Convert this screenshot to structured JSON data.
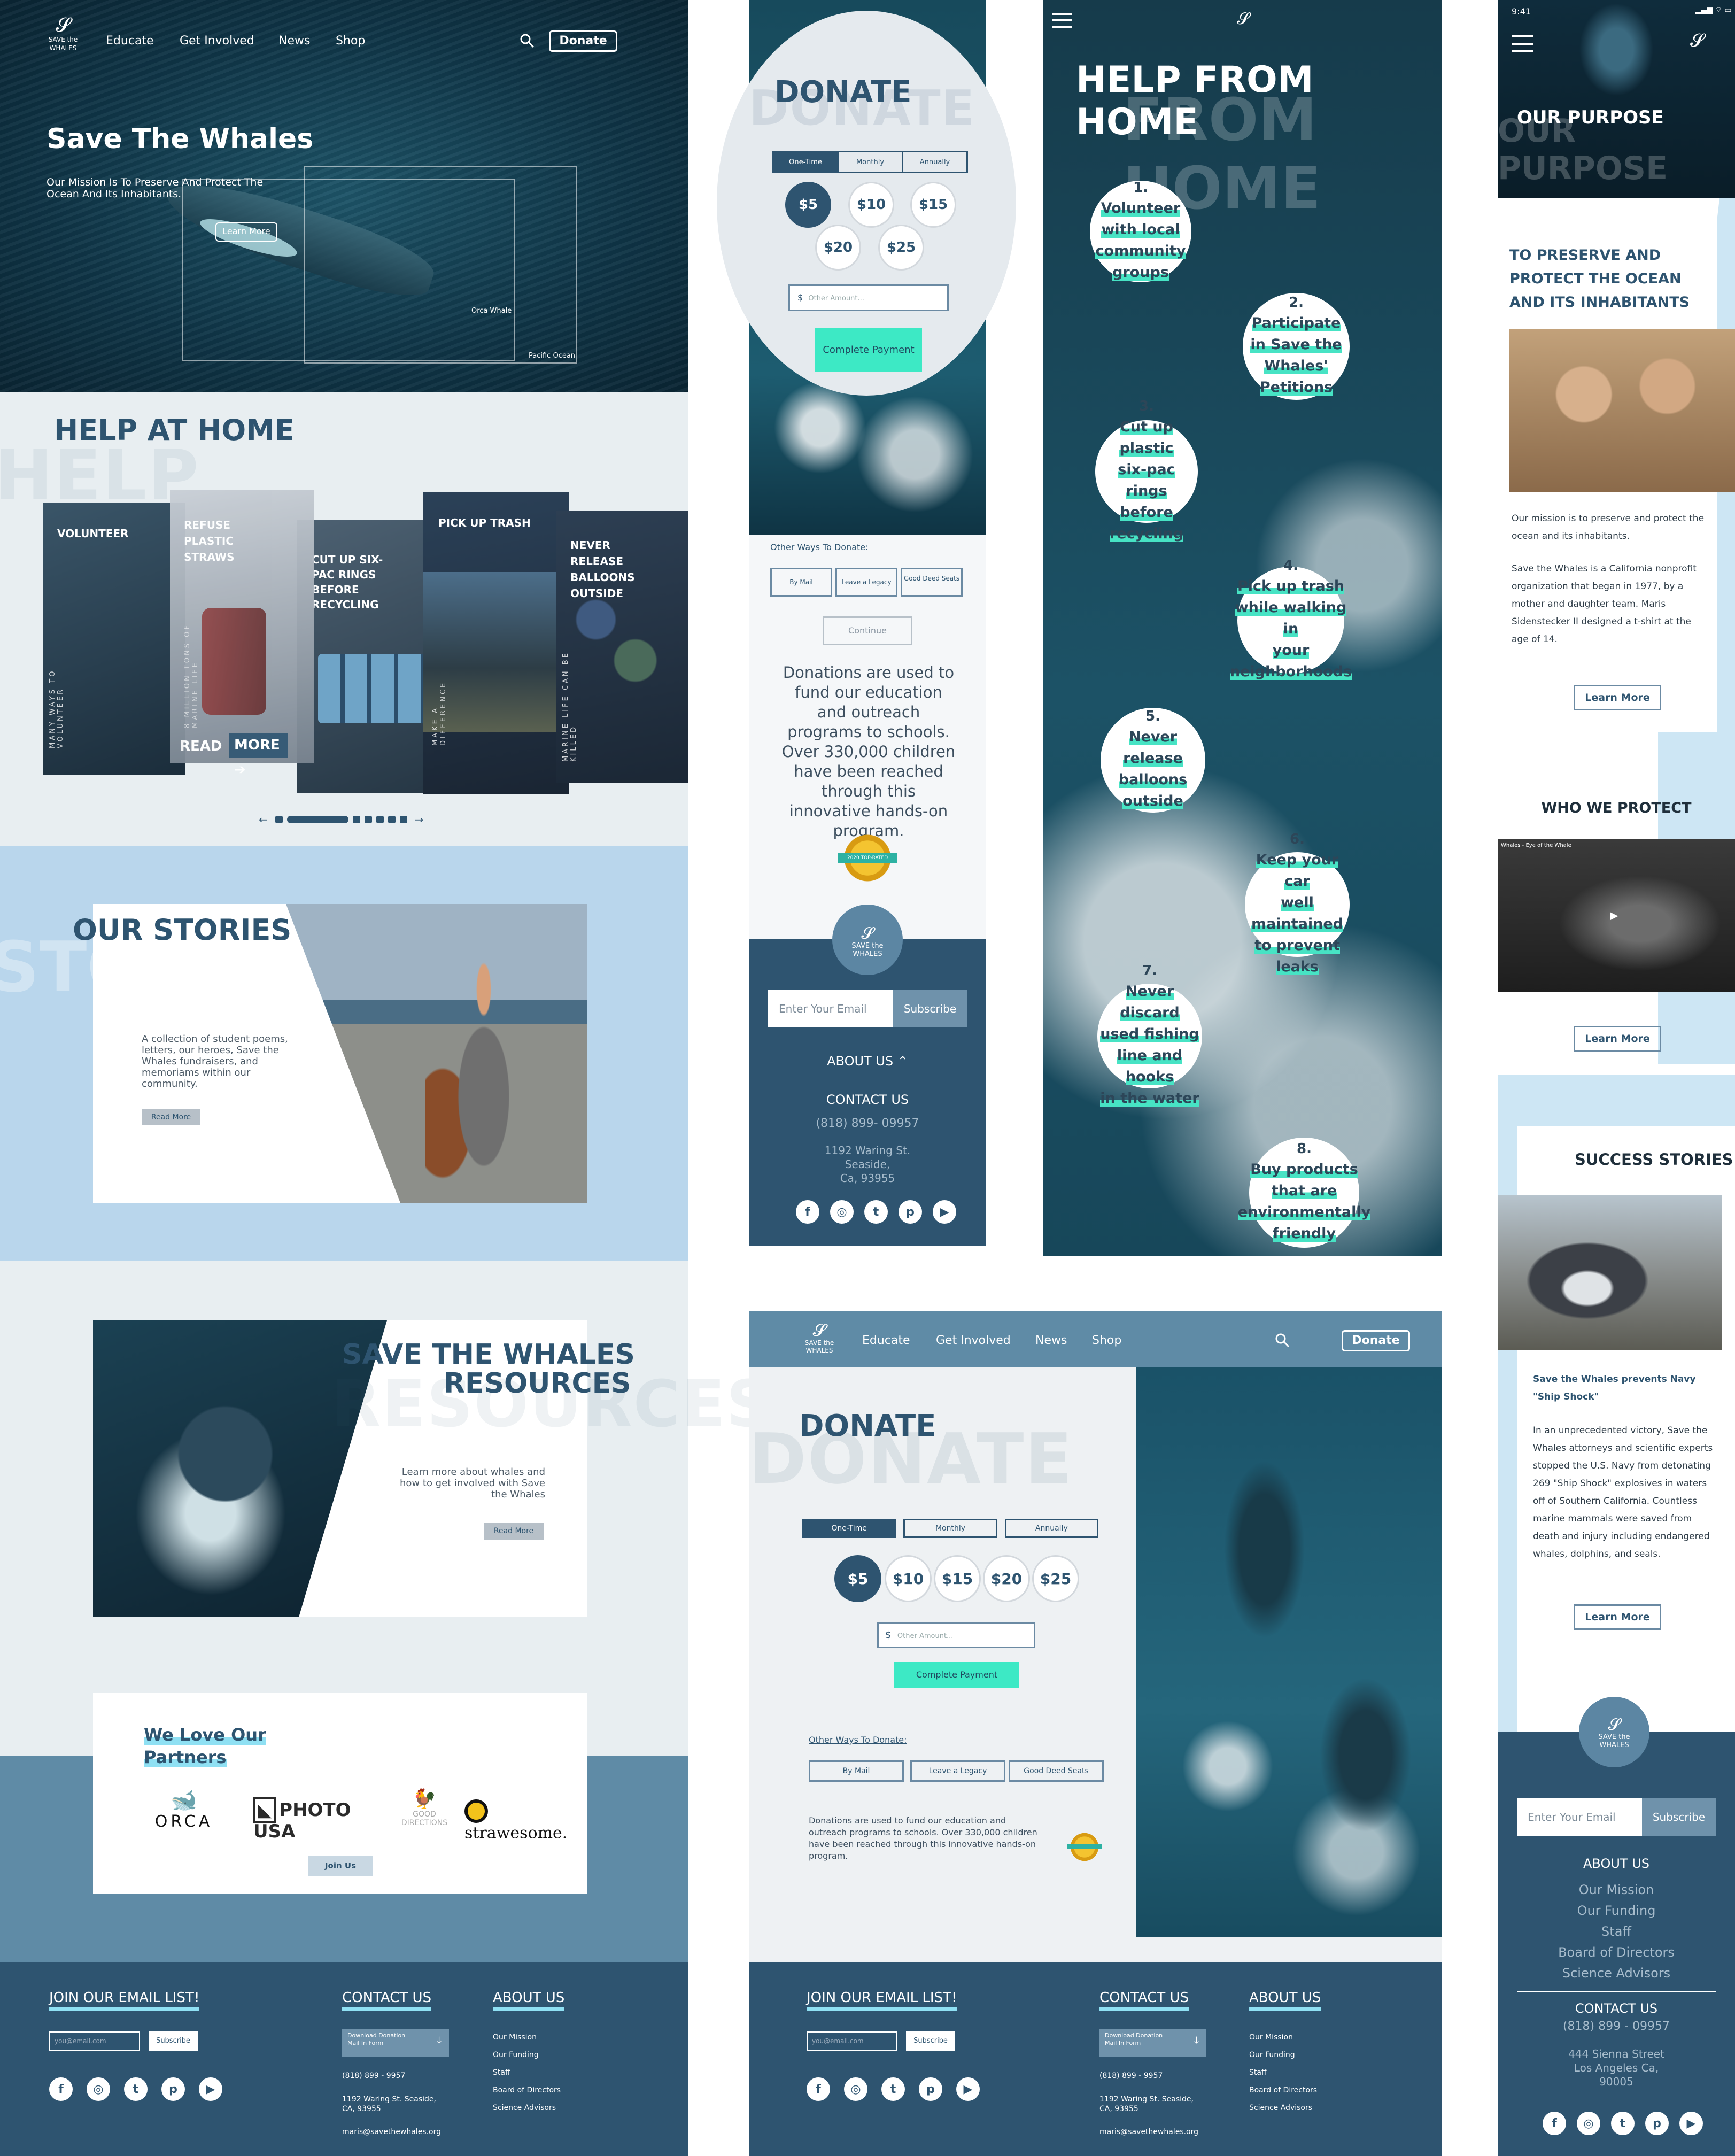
{
  "desktop": {
    "nav": {
      "items": [
        "Educate",
        "Get Involved",
        "News",
        "Shop"
      ],
      "donate": "Donate"
    },
    "hero": {
      "title": "Save The Whales",
      "subtitle": "Our Mission Is To Preserve And Protect The Ocean And Its Inhabitants.",
      "cta": "Learn More",
      "tag1": "Orca Whale",
      "tag2": "Pacific Ocean"
    },
    "help": {
      "title": "HELP AT HOME",
      "ghost": "HELP",
      "cards": [
        {
          "title": "VOLUNTEER",
          "side": "MANY WAYS TO VOLUNTEER"
        },
        {
          "title": "REFUSE PLASTIC STRAWS",
          "side": "8 MILLION TONS OF MARINE LIFE",
          "read": "READ",
          "more": "MORE"
        },
        {
          "title": "CUT UP SIX-PAC RINGS BEFORE RECYCLING",
          "side": ""
        },
        {
          "title": "PICK UP TRASH",
          "side": "MAKE A DIFFERENCE"
        },
        {
          "title": "NEVER RELEASE BALLOONS OUTSIDE",
          "side": "MARINE LIFE CAN BE KILLED"
        }
      ]
    },
    "stories": {
      "title": "OUR STORIES",
      "ghost": "STORIES",
      "text": "A collection of student poems, letters, our heroes, Save the Whales fundraisers, and memoriams within our community.",
      "cta": "Read More"
    },
    "resources": {
      "title1": "SAVE THE WHALES",
      "title2": "RESOURCES",
      "ghost": "RESOURCES",
      "text": "Learn more about whales and how to get involved with Save the Whales",
      "cta": "Read More"
    },
    "partners": {
      "title1": "We Love Our",
      "title2": "Partners",
      "logos": [
        "ORCA",
        "PHOTO USA",
        "GOOD DIRECTIONS",
        "strawesome."
      ],
      "cta": "Join Us"
    },
    "footer": {
      "email_title": "JOIN OUR EMAIL LIST!",
      "email_ph": "you@email.com",
      "subscribe": "Subscribe",
      "contact_title": "CONTACT US",
      "download": "Download Donation Mail In Form",
      "phone": "(818) 899 - 9957",
      "address": "1192 Waring St. Seaside, CA, 93955",
      "email": "maris@savethewhales.org",
      "about_title": "ABOUT US",
      "about_items": [
        "Our Mission",
        "Our Funding",
        "Staff",
        "Board of Directors",
        "Science Advisors"
      ]
    }
  },
  "mobile_donate": {
    "title": "DONATE",
    "ghost": "DONATE",
    "freq": [
      "One-Time",
      "Monthly",
      "Annually"
    ],
    "amounts": [
      "$5",
      "$10",
      "$15",
      "$20",
      "$25"
    ],
    "other_ph": "Other Amount...",
    "pay": "Complete Payment",
    "other_ways": "Other Ways To Donate:",
    "ways": [
      "By Mail",
      "Leave a Legacy",
      "Good Deed Seats"
    ],
    "continue": "Continue",
    "text": "Donations are used to fund our education and outreach programs to schools. Over 330,000 children have been reached through this innovative hands-on program.",
    "badge": "2020 TOP-RATED",
    "footer": {
      "email_ph": "Enter Your Email",
      "subscribe": "Subscribe",
      "about": "ABOUT US",
      "contact": "CONTACT US",
      "phone": "(818) 899- 09957",
      "addr1": "1192 Waring St.",
      "addr2": "Seaside,",
      "addr3": "Ca, 93955"
    }
  },
  "help_from_home": {
    "title": "HELP FROM HOME",
    "ghost": "FROM HOME",
    "steps": [
      {
        "n": "1.",
        "t": [
          "Volunteer",
          "with local",
          "community",
          "groups"
        ]
      },
      {
        "n": "2.",
        "t": [
          "Participate",
          "in Save the",
          "Whales'",
          "Petitions"
        ]
      },
      {
        "n": "3.",
        "t": [
          "Cut up plastic",
          "six-pac rings",
          "before",
          "recycling"
        ]
      },
      {
        "n": "4.",
        "t": [
          "Pick up trash",
          "while walking in",
          "your",
          "neighborhoods"
        ]
      },
      {
        "n": "5.",
        "t": [
          "Never",
          "release",
          "balloons",
          "outside"
        ]
      },
      {
        "n": "6.",
        "t": [
          "Keep your car",
          "well maintained",
          "to prevent leaks"
        ]
      },
      {
        "n": "7.",
        "t": [
          "Never discard",
          "used fishing",
          "line and hooks",
          "in the water"
        ]
      },
      {
        "n": "8.",
        "t": [
          "Buy products",
          "that are",
          "environmentally",
          "friendly"
        ]
      }
    ]
  },
  "desktop_donate": {
    "nav": {
      "items": [
        "Educate",
        "Get Involved",
        "News",
        "Shop"
      ],
      "donate": "Donate"
    },
    "title": "DONATE",
    "ghost": "DONATE",
    "freq": [
      "One-Time",
      "Monthly",
      "Annually"
    ],
    "amounts": [
      "$5",
      "$10",
      "$15",
      "$20",
      "$25"
    ],
    "other_ph": "Other Amount...",
    "pay": "Complete Payment",
    "other_ways": "Other Ways To Donate:",
    "ways": [
      "By Mail",
      "Leave a Legacy",
      "Good Deed Seats"
    ],
    "text": "Donations are used to fund our education and outreach programs to schools. Over 330,000 children have been reached through this innovative hands-on program."
  },
  "mobile_about": {
    "time": "9:41",
    "purpose": "OUR PURPOSE",
    "ghost": "OUR PURPOSE",
    "lead": "TO PRESERVE AND PROTECT THE OCEAN AND ITS INHABITANTS",
    "p1": "Our mission is to preserve and protect the ocean and its inhabitants.",
    "p2": "Save the Whales is a California nonprofit organization that began in 1977, by a mother and daughter team. Maris Sidenstecker II designed a t-shirt at the age of 14.",
    "learn": "Learn More",
    "protect": "WHO WE PROTECT",
    "video_caption": "Whales - Eye of the Whale",
    "success": "SUCCESS STORIES",
    "story_title": "Save the Whales prevents Navy \"Ship Shock\"",
    "story": "In an unprecedented victory, Save the Whales attorneys and scientific experts stopped the U.S. Navy from detonating 269 \"Ship Shock\" explosives in waters off of Southern California. Countless marine mammals were saved from death and injury including endangered whales, dolphins, and seals.",
    "footer": {
      "email_ph": "Enter Your Email",
      "subscribe": "Subscribe",
      "about": "ABOUT US",
      "about_items": [
        "Our Mission",
        "Our Funding",
        "Staff",
        "Board of Directors",
        "Science Advisors"
      ],
      "contact": "CONTACT US",
      "phone": "(818) 899 - 09957",
      "addr1": "444 Sienna Street",
      "addr2": "Los Angeles Ca,",
      "addr3": "90005"
    }
  },
  "brand": {
    "logo_top": "SAVE the",
    "logo_bottom": "WHALES"
  },
  "colors": {
    "navy": "#2e5470",
    "mint": "#3de9c5",
    "light_blue": "#b9d6ec",
    "pale": "#e8eef1"
  },
  "social_icons": [
    "facebook-icon",
    "instagram-icon",
    "twitter-icon",
    "pinterest-icon",
    "youtube-icon"
  ]
}
